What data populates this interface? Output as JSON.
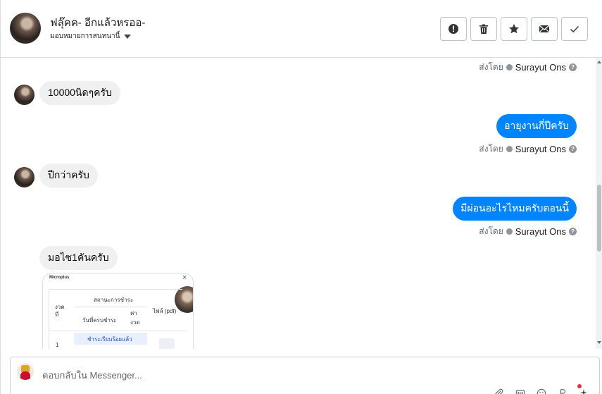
{
  "header": {
    "contact_name": "ฟลุ๊คค- อีกแล้วหรออ-",
    "label": "มอบหมายการสนทนานี้",
    "actions": [
      {
        "name": "mark-spam-button",
        "icon": "alert-circle-icon"
      },
      {
        "name": "delete-button",
        "icon": "trash-icon"
      },
      {
        "name": "star-button",
        "icon": "star-icon"
      },
      {
        "name": "mark-unread-button",
        "icon": "envelope-icon"
      },
      {
        "name": "mark-done-button",
        "icon": "check-icon"
      }
    ]
  },
  "thread": {
    "sent_by_prefix": "ส่งโดย",
    "sender_name": "Surayut Ons",
    "messages": [
      {
        "direction": "in",
        "text": "10000นิดๆครับ"
      },
      {
        "direction": "out",
        "text": "อายุงานกี่ปีครับ"
      },
      {
        "direction": "in",
        "text": "ปีกว่าครับ"
      },
      {
        "direction": "out",
        "text": "มีผ่อนอะไรไหมครับตอนนี้"
      },
      {
        "direction": "in",
        "text": "มอไซ1คันครับ"
      }
    ],
    "attachment": {
      "brand": "Microplus",
      "close": "×",
      "payment_status_header": "สถานะการชำระ",
      "col_installment": "งวด ที่",
      "col_due_date": "วันที่ครบชำระ",
      "col_amount": "ค่า งวด",
      "col_file": "ไฟล์ (pdf)",
      "row_number": "1",
      "paid_status": "ชำระเรียบร้อยแล้ว"
    }
  },
  "composer": {
    "placeholder": "ตอบกลับใน Messenger...",
    "tools": [
      "attachment-icon",
      "gif-icon",
      "emoji-icon",
      "saved-reply-icon",
      "magic-icon"
    ]
  }
}
